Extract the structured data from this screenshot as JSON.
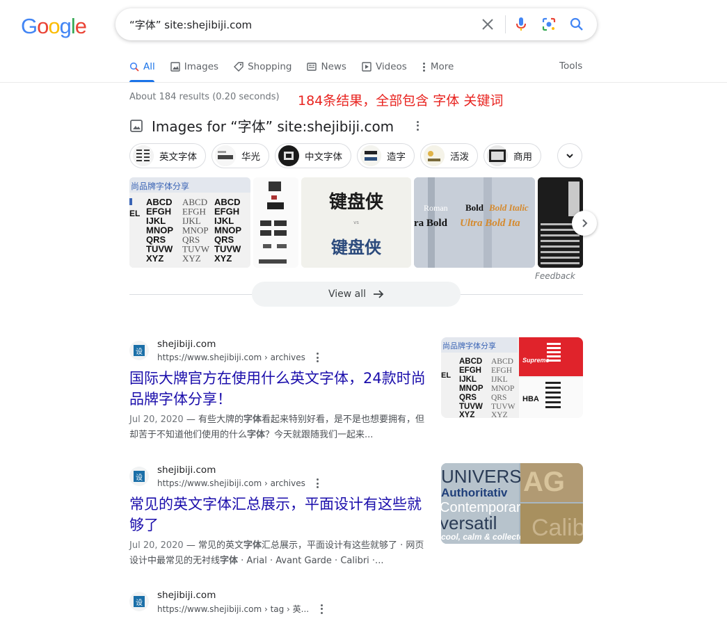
{
  "header": {
    "logo": [
      "G",
      "o",
      "o",
      "g",
      "l",
      "e"
    ],
    "logo_colors": [
      "#4285f4",
      "#ea4335",
      "#fbbc05",
      "#4285f4",
      "#34a853",
      "#ea4335"
    ],
    "query": "“字体” site:shejibiji.com"
  },
  "tabs": [
    {
      "label": "All",
      "icon": "search-icon"
    },
    {
      "label": "Images",
      "icon": "image-icon"
    },
    {
      "label": "Shopping",
      "icon": "tag-icon"
    },
    {
      "label": "News",
      "icon": "news-icon"
    },
    {
      "label": "Videos",
      "icon": "play-icon"
    },
    {
      "label": "More",
      "icon": "more-vert-icon"
    }
  ],
  "tools": "Tools",
  "stats": "About 184 results (0.20 seconds)",
  "annotation": "184条结果，全部包含 字体 关键词",
  "images_section": {
    "heading": "Images for “字体” site:shejibiji.com",
    "chips": [
      "英文字体",
      "华光",
      "中文字体",
      "造字",
      "活泼",
      "商用"
    ],
    "feedback": "Feedback",
    "view_all": "View all"
  },
  "image_text": {
    "img1_title": "尚品牌字体分享",
    "img1_col1": [
      "ABCD",
      "EFGH",
      "IJKL",
      "MNOP",
      "QRS",
      "TUVW",
      "XYZ"
    ],
    "img3_title": "键盘侠",
    "img3_vs": "vs",
    "img4_words": [
      "Roman",
      "Bold",
      "Bold Italic",
      "ra Bold",
      "Ultra Bold Ita"
    ]
  },
  "results": [
    {
      "site": "shejibiji.com",
      "url": "https://www.shejibiji.com › archives",
      "title": "国际大牌官方在使用什么英文字体，24款时尚品牌字体分享！",
      "date": "Jul 20, 2020",
      "snippet_html_parts": [
        "— 有些大牌的",
        "字体",
        "看起来特别好看，是不是也想要拥有，但却苦于不知道他们使用的什么",
        "字体",
        "？今天就跟随我们一起来..."
      ],
      "thumb_label": "尚品牌字体分享",
      "thumb_words": [
        "Supreme",
        "HBA"
      ]
    },
    {
      "site": "shejibiji.com",
      "url": "https://www.shejibiji.com › archives",
      "title": "常见的英文字体汇总展示，平面设计有这些就够了",
      "date": "Jul 20, 2020",
      "snippet_html_parts": [
        "— 常见的英文",
        "字体",
        "汇总展示，平面设计有这些就够了 · 网页设计中最常见的无衬线",
        "字体",
        " · Arial · Avant Garde · Calibri ·..."
      ],
      "thumb_words": [
        "UNIVERSA",
        "Authoritativ",
        "Contemporar",
        "versatil",
        "cool, calm & collecte",
        "AG",
        "Calibri"
      ]
    },
    {
      "site": "shejibiji.com",
      "url": "https://www.shejibiji.com › tag › 英..."
    }
  ],
  "favicon_char": "设"
}
